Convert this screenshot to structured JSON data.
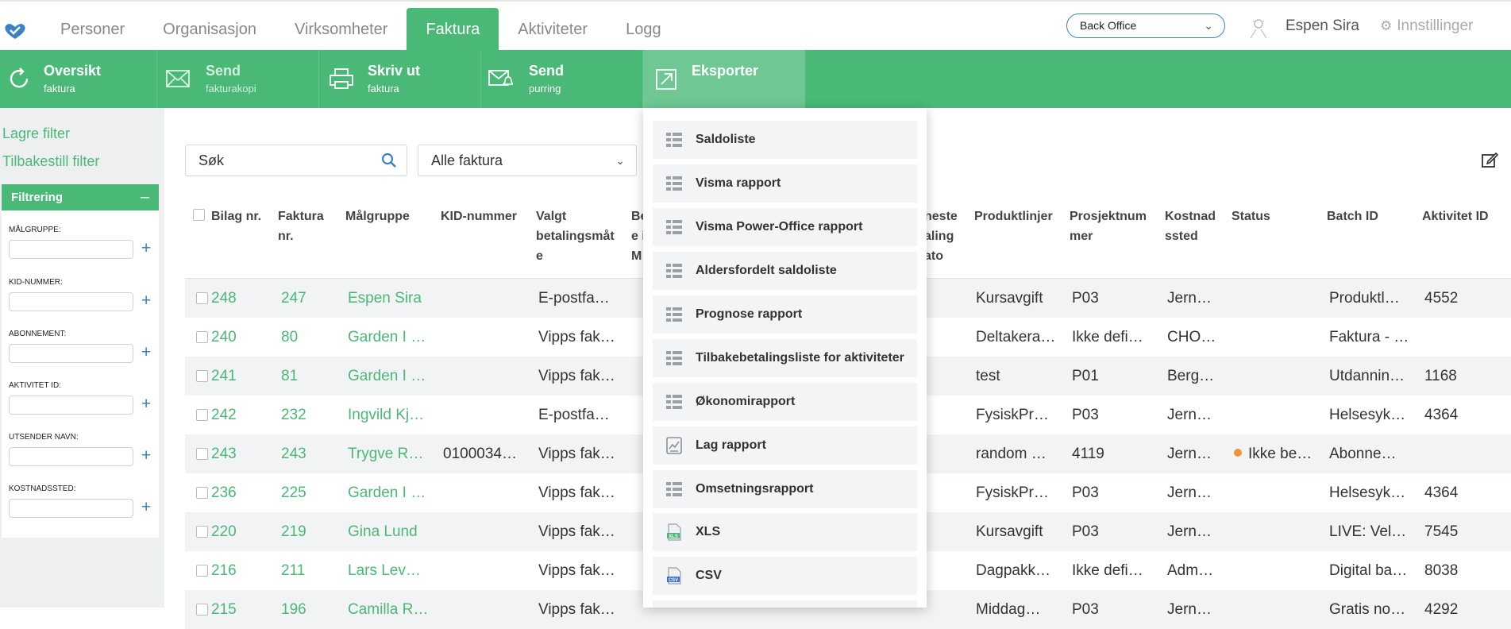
{
  "nav": {
    "tabs": [
      "Personer",
      "Organisasjon",
      "Virksomheter",
      "Faktura",
      "Aktiviteter",
      "Logg"
    ],
    "active_tab": "Faktura",
    "office_select": "Back Office",
    "user_name": "Espen Sira",
    "settings_label": "Innstillinger"
  },
  "actions": [
    {
      "title": "Oversikt",
      "subtitle": "faktura",
      "icon": "refresh-icon"
    },
    {
      "title": "Send",
      "subtitle": "fakturakopi",
      "icon": "envelope-icon"
    },
    {
      "title": "Skriv ut",
      "subtitle": "faktura",
      "icon": "printer-icon"
    },
    {
      "title": "Send",
      "subtitle": "purring",
      "icon": "envelope-bell-icon"
    },
    {
      "title": "Eksporter",
      "subtitle": "",
      "icon": "export-arrow-icon"
    }
  ],
  "sidebar": {
    "save_filter": "Lagre filter",
    "reset_filter": "Tilbakestill filter",
    "filter_title": "Filtrering",
    "filters": [
      "Målgruppe:",
      "KID-nummer:",
      "Abonnement:",
      "Aktivitet ID:",
      "Utsender navn:",
      "Kostnadssted:"
    ]
  },
  "search": {
    "placeholder": "Søk"
  },
  "invoice_filter": "Alle faktura",
  "table": {
    "headers": {
      "bilag": "Bilag nr.",
      "faktura": [
        "Faktura",
        "nr."
      ],
      "malgruppe": "Målgruppe",
      "kid": "KID-nummer",
      "betaling": [
        "Valgt",
        "betalingsmåt",
        "e"
      ],
      "be": [
        "Be",
        "e i",
        "M"
      ],
      "neste": [
        "neste",
        "aling",
        "ato"
      ],
      "produkt": "Produktlinjer",
      "prosjekt": [
        "Prosjektnum",
        "mer"
      ],
      "kostnad": [
        "Kostnad",
        "ssted"
      ],
      "status": "Status",
      "batch": "Batch ID",
      "aktivitet": "Aktivitet ID"
    },
    "rows": [
      {
        "bilag": "248",
        "faktura": "247",
        "malgruppe": "Espen Sira",
        "kid": "",
        "betaling": "E-postfa…",
        "produkt": "Kursavgift",
        "prosjekt": "P03",
        "kostnad": "Jern…",
        "status": "",
        "batch": "Produktl…",
        "aktivitet": "4552"
      },
      {
        "bilag": "240",
        "faktura": "80",
        "malgruppe": "Garden I …",
        "kid": "",
        "betaling": "Vipps fak…",
        "produkt": "Deltakera…",
        "prosjekt": "Ikke defi…",
        "kostnad": "CHO…",
        "status": "",
        "batch": "Faktura - …",
        "aktivitet": ""
      },
      {
        "bilag": "241",
        "faktura": "81",
        "malgruppe": "Garden I …",
        "kid": "",
        "betaling": "Vipps fak…",
        "produkt": "test",
        "prosjekt": "P01",
        "kostnad": "Berg…",
        "status": "",
        "batch": "Utdannin…",
        "aktivitet": "1168"
      },
      {
        "bilag": "242",
        "faktura": "232",
        "malgruppe": "Ingvild Kj…",
        "kid": "",
        "betaling": "E-postfa…",
        "produkt": "FysiskPr…",
        "prosjekt": "P03",
        "kostnad": "Jern…",
        "status": "",
        "batch": "Helsesyk…",
        "aktivitet": "4364"
      },
      {
        "bilag": "243",
        "faktura": "243",
        "malgruppe": "Trygve R…",
        "kid": "0100034…",
        "betaling": "Vipps fak…",
        "produkt": "random …",
        "prosjekt": "4119",
        "kostnad": "Jern…",
        "status": "Ikke be…",
        "batch": "Abonne…",
        "aktivitet": ""
      },
      {
        "bilag": "236",
        "faktura": "225",
        "malgruppe": "Garden I …",
        "kid": "",
        "betaling": "Vipps fak…",
        "produkt": "FysiskPr…",
        "prosjekt": "P03",
        "kostnad": "Jern…",
        "status": "",
        "batch": "Helsesyk…",
        "aktivitet": "4364"
      },
      {
        "bilag": "220",
        "faktura": "219",
        "malgruppe": "Gina Lund",
        "kid": "",
        "betaling": "Vipps fak…",
        "produkt": "Kursavgift",
        "prosjekt": "P03",
        "kostnad": "Jern…",
        "status": "",
        "batch": "LIVE: Vel…",
        "aktivitet": "7545"
      },
      {
        "bilag": "216",
        "faktura": "211",
        "malgruppe": "Lars Lev…",
        "kid": "",
        "betaling": "Vipps fak…",
        "produkt": "Dagpakk…",
        "prosjekt": "Ikke defi…",
        "kostnad": "Adm…",
        "status": "",
        "batch": "Digital ba…",
        "aktivitet": "8038"
      },
      {
        "bilag": "215",
        "faktura": "196",
        "malgruppe": "Camilla R…",
        "kid": "",
        "betaling": "Vipps fak…",
        "produkt": "Middag…",
        "prosjekt": "P03",
        "kostnad": "Jern…",
        "status": "",
        "batch": "Gratis no…",
        "aktivitet": "4292"
      }
    ]
  },
  "export_menu": [
    {
      "label": "Saldoliste",
      "icon": "grid-list-icon"
    },
    {
      "label": "Visma rapport",
      "icon": "grid-list-icon"
    },
    {
      "label": "Visma Power-Office rapport",
      "icon": "grid-list-icon"
    },
    {
      "label": "Aldersfordelt saldoliste",
      "icon": "grid-list-icon"
    },
    {
      "label": "Prognose rapport",
      "icon": "grid-list-icon"
    },
    {
      "label": "Tilbakebetalingsliste for aktiviteter",
      "icon": "grid-list-icon"
    },
    {
      "label": "Økonomirapport",
      "icon": "grid-list-icon"
    },
    {
      "label": "Lag rapport",
      "icon": "chart-report-icon"
    },
    {
      "label": "Omsetningsrapport",
      "icon": "grid-list-icon"
    },
    {
      "label": "XLS",
      "icon": "xls-file-icon"
    },
    {
      "label": "CSV",
      "icon": "csv-file-icon"
    }
  ],
  "colors": {
    "green": "#4ab876",
    "green_light": "#6fc893",
    "blue": "#3b82c4",
    "orange_status": "#f0923a"
  }
}
